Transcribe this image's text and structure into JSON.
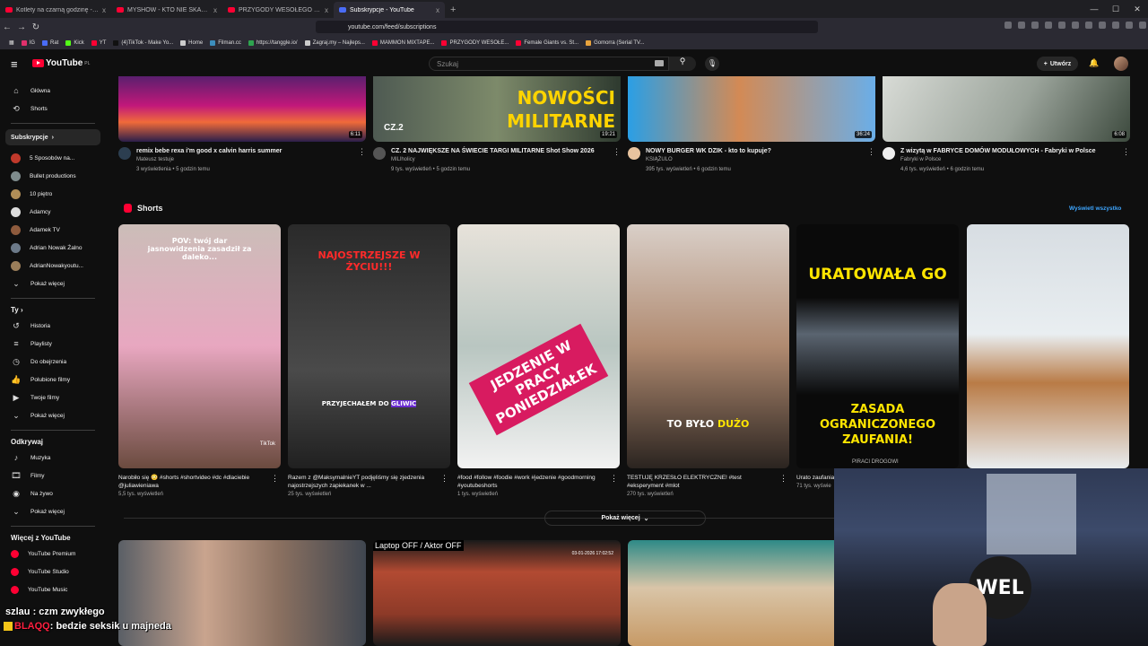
{
  "browser": {
    "tabs": [
      {
        "label": "Kotlety na czarną godzinę - mogą st",
        "color": "#ff0033",
        "active": false
      },
      {
        "label": "MYSHOW - KTO NIE SKACZE TEN Z",
        "color": "#ff0033",
        "active": false
      },
      {
        "label": "PRZYGODY WESOŁEGO MAZURA wi",
        "color": "#ff0033",
        "active": false
      },
      {
        "label": "Subskrypcje - YouTube",
        "color": "#4a6cf7",
        "active": true
      }
    ],
    "new_tab": "+",
    "close": "x",
    "url": "youtube.com/feed/subscriptions",
    "bookmarks": [
      {
        "label": "IG",
        "color": "#e1306c"
      },
      {
        "label": "Rat",
        "color": "#4a6cf7"
      },
      {
        "label": "Kick",
        "color": "#53fc18"
      },
      {
        "label": "YT",
        "color": "#ff0033"
      },
      {
        "label": "(4)TikTok - Make Yo...",
        "color": "#222222"
      },
      {
        "label": "Home",
        "color": "#cccccc"
      },
      {
        "label": "Filman.cc",
        "color": "#3c8dbc"
      },
      {
        "label": "https://tanggle.io/",
        "color": "#2ea44f"
      },
      {
        "label": "Zagraj.my – Najleps...",
        "color": "#cccccc"
      },
      {
        "label": "MAMMON MIXTAPE...",
        "color": "#ff0033"
      },
      {
        "label": "PRZYGODY WESOŁE...",
        "color": "#ff0033"
      },
      {
        "label": "Female Giants vs. St...",
        "color": "#ff0033"
      },
      {
        "label": "Gomorra (Serial TV...",
        "color": "#e8a33d"
      }
    ]
  },
  "yt": {
    "logo": "YouTube",
    "region": "PL",
    "search_placeholder": "Szukaj",
    "create_label": "Utwórz",
    "sidebar": {
      "main": [
        {
          "label": "Główna",
          "icon": "⌂"
        },
        {
          "label": "Shorts",
          "icon": "⟲"
        }
      ],
      "subs_header": "Subskrypcje",
      "subs": [
        {
          "label": "5 Sposobów na...",
          "color": "#c0392b"
        },
        {
          "label": "Bullet productions",
          "color": "#7f8c8d"
        },
        {
          "label": "10 piętro",
          "color": "#b08d57"
        },
        {
          "label": "Adamcy",
          "color": "#dcdcdc"
        },
        {
          "label": "Adamek TV",
          "color": "#8e5b3d"
        },
        {
          "label": "Adrian Nowak Żalno",
          "color": "#6c7a89"
        },
        {
          "label": "AdrianNowakyoutu...",
          "color": "#9b7e5a"
        }
      ],
      "subs_more": "Pokaż więcej",
      "you_header": "Ty",
      "you": [
        {
          "label": "Historia",
          "icon": "↺"
        },
        {
          "label": "Playlisty",
          "icon": "≡"
        },
        {
          "label": "Do obejrzenia",
          "icon": "◷"
        },
        {
          "label": "Polubione filmy",
          "icon": "👍"
        },
        {
          "label": "Twoje filmy",
          "icon": "▶"
        }
      ],
      "you_more": "Pokaż więcej",
      "explore_header": "Odkrywaj",
      "explore": [
        {
          "label": "Muzyka",
          "icon": "♪"
        },
        {
          "label": "Filmy",
          "icon": "🎞"
        },
        {
          "label": "Na żywo",
          "icon": "◉"
        }
      ],
      "explore_more": "Pokaż więcej",
      "more_header": "Więcej z YouTube",
      "more": [
        {
          "label": "YouTube Premium"
        },
        {
          "label": "YouTube Studio"
        },
        {
          "label": "YouTube Music"
        }
      ]
    },
    "top_videos": [
      {
        "title": "remix bebe rexa i'm good x calvin harris summer",
        "channel": "Mateusz testuje",
        "meta": "3 wyświetlenia • 5 godzin temu",
        "duration": "6:11",
        "ch_color": "#2c3e50"
      },
      {
        "title": "CZ. 2 NAJWIĘKSZE NA ŚWIECIE TARGI MILITARNE Shot Show 2026",
        "channel": "MILlholicy",
        "meta": "9 tys. wyświetleń • 5 godzin temu",
        "duration": "19:21",
        "ch_color": "#555555"
      },
      {
        "title": "NOWY BURGER WK DZIK - kto to kupuje?",
        "channel": "KSIĄŻULO",
        "meta": "395 tys. wyświetleń • 6 godzin temu",
        "duration": "36:24",
        "ch_color": "#e8c39e"
      },
      {
        "title": "Z wizytą w FABRYCE DOMÓW MODUŁOWYCH - Fabryki w Polsce",
        "channel": "Fabryki w Polsce",
        "meta": "4,6 tys. wyświetleń • 6 godzin temu",
        "duration": "6:08",
        "ch_color": "#eeeeee"
      }
    ],
    "thumb_text": {
      "v2a": "NOWOŚCI",
      "v2b": "MILITARNE",
      "v2c": "CZ.2"
    },
    "shorts_header": "Shorts",
    "view_all": "Wyświetl wszystko",
    "shorts": [
      {
        "title": "Narobiło się 😳 #shorts #shortvideo #dc #dlaciebie @juliawieniawa",
        "views": "5,5 tys. wyświetleń",
        "overlay": "POV: twój dar jasnowidzenia zasadził za daleko...",
        "tiktok": "TikTok"
      },
      {
        "title": "Razem z @MaksymalnieYT podjęliśmy się zjedzenia najostrzejszych zapiekanek w ...",
        "views": "25 tys. wyświetleń",
        "overlay": "NAJOSTRZEJSZE W ŻYCIU!!!",
        "sub": "PRZYJECHAŁEM DO",
        "sub_hl": "GLIWIC"
      },
      {
        "title": "#food #follow #foodie #work #jedzenie #goodmorning #youtubeshorts",
        "views": "1 tys. wyświetleń",
        "overlay": "JEDZENIE W PRACY PONIEDZIAŁEK"
      },
      {
        "title": "TESTUJĘ KRZESŁO ELEKTRYCZNE! #test #eksperyment #mlot",
        "views": "270 tys. wyświetleń",
        "overlay": "TO BYŁO",
        "overlay_hl": "DUŻO"
      },
      {
        "title": "Urato zaufania",
        "views": "71 tys. wyświe",
        "overlay": "URATOWAŁA GO",
        "sub": "ZASADA OGRANICZONEGO ZAUFANIA!",
        "badge": "PIRACI DROGOWI"
      },
      {
        "title": "",
        "views": "",
        "overlay": ""
      }
    ],
    "show_more": "Pokaż więcej",
    "bottom_thumb_text": {
      "v2": "Laptop OFF / Aktor OFF",
      "v2_ts": "03-01-2026 17:02:52"
    }
  },
  "overlay": {
    "chat": [
      {
        "user": "",
        "text": "szlau : czm zwykłego"
      },
      {
        "user": "BLAQQ",
        "text": ": bedzie seksik u majneda"
      }
    ],
    "webcam_sign": "WEL"
  }
}
